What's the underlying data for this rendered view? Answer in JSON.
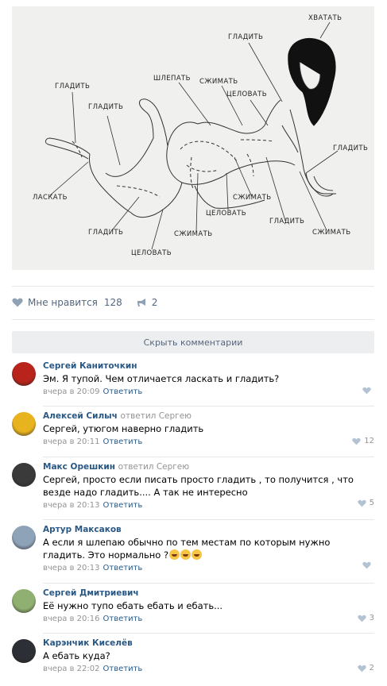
{
  "illustration": {
    "labels": {
      "hvatat": "ХВАТАТЬ",
      "gladit_top": "ГЛАДИТЬ",
      "shlepat": "ШЛЕПАТЬ",
      "szhimat_top": "СЖИМАТЬ",
      "celovat_top": "ЦЕЛОВАТЬ",
      "gladit_left": "ГЛАДИТЬ",
      "gladit_leg": "ГЛАДИТЬ",
      "gladit_right": "ГЛАДИТЬ",
      "laskat": "ЛАСКАТЬ",
      "szhimat_mid": "СЖИМАТЬ",
      "celovat_mid": "ЦЕЛОВАТЬ",
      "gladit_mid": "ГЛАДИТЬ",
      "szhimat_right": "СЖИМАТЬ",
      "gladit_bottom": "ГЛАДИТЬ",
      "szhimat_bottom": "СЖИМАТЬ",
      "celovat_bottom": "ЦЕЛОВАТЬ"
    }
  },
  "post": {
    "like_label": "Мне нравится",
    "like_count": "128",
    "share_count": "2",
    "hide_comments": "Скрыть комментарии"
  },
  "comments": [
    {
      "author": "Сергей Каниточкин",
      "reply_to": "",
      "text": "Эм. Я тупой. Чем отличается ласкать и гладить?",
      "time": "вчера в 20:09",
      "reply": "Ответить",
      "likes": "",
      "avatar_color": "#b8241c"
    },
    {
      "author": "Алексей Силыч",
      "reply_to": "ответил Сергею",
      "text": "Сергей, утюгом наверно гладить",
      "time": "вчера в 20:11",
      "reply": "Ответить",
      "likes": "12",
      "avatar_color": "#e7b31e"
    },
    {
      "author": "Макс Орешкин",
      "reply_to": "ответил Сергею",
      "text": "Сергей, просто если писать просто гладить , то получится , что везде надо гладить.... А так не интересно",
      "time": "вчера в 20:13",
      "reply": "Ответить",
      "likes": "5",
      "avatar_color": "#3a3a3a"
    },
    {
      "author": "Артур Максаков",
      "reply_to": "",
      "text": "А если я шлепаю обычно по тем местам по которым нужно гладить. Это нормально ?",
      "time": "вчера в 20:13",
      "reply": "Ответить",
      "likes": "",
      "avatar_color": "#8fa3b8"
    },
    {
      "author": "Сергей Дмитриевич",
      "reply_to": "",
      "text": "Её нужно тупо ебать ебать и ебать...",
      "time": "вчера в 20:16",
      "reply": "Ответить",
      "likes": "3",
      "avatar_color": "#8fb070"
    },
    {
      "author": "Карэнчик Киселёв",
      "reply_to": "",
      "text": "А ебать куда?",
      "time": "вчера в 22:02",
      "reply": "Ответить",
      "likes": "2",
      "avatar_color": "#2d2f36"
    }
  ]
}
